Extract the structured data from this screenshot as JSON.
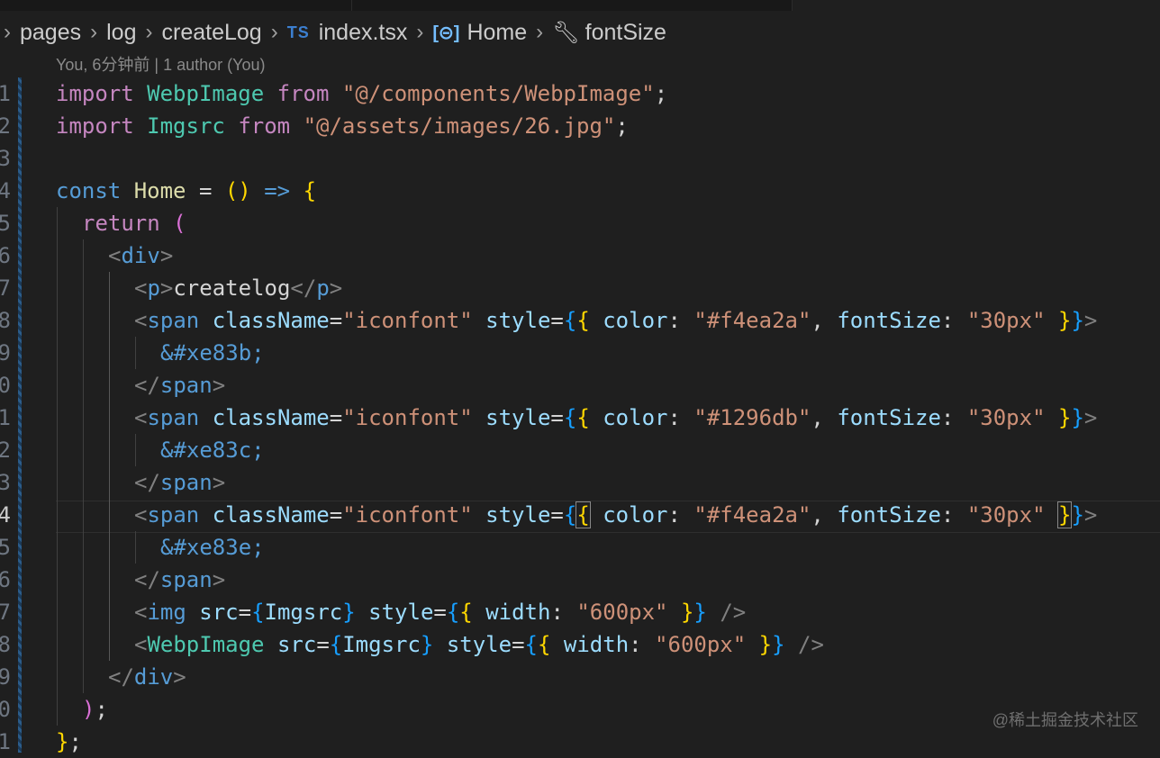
{
  "breadcrumb": {
    "items": [
      "pages",
      "log",
      "createLog",
      "index.tsx",
      "Home",
      "fontSize"
    ],
    "file_badge": "TS"
  },
  "blame": "You, 6分钟前 | 1 author (You)",
  "line_numbers": [
    "1",
    "2",
    "3",
    "4",
    "5",
    "6",
    "7",
    "8",
    "9",
    "0",
    "1",
    "2",
    "3",
    "4",
    "5",
    "6",
    "7",
    "8",
    "9",
    "0",
    "1"
  ],
  "code": {
    "l1": [
      "import",
      " ",
      "WebpImage",
      " ",
      "from",
      " ",
      "\"@/components/WebpImage\"",
      ";"
    ],
    "l2": [
      "import",
      " ",
      "Imgsrc",
      " ",
      "from",
      " ",
      "\"@/assets/images/26.jpg\"",
      ";"
    ],
    "l4": [
      "const",
      " ",
      "Home",
      " = ",
      "()",
      " => ",
      "{"
    ],
    "l5": [
      "return",
      " ",
      "("
    ],
    "l6": [
      "<",
      "div",
      ">"
    ],
    "l7": [
      "<",
      "p",
      ">",
      "createlog",
      "</",
      "p",
      ">"
    ],
    "l8": [
      "<",
      "span",
      " ",
      "className",
      "=",
      "\"iconfont\"",
      " ",
      "style",
      "=",
      "{",
      "{",
      " ",
      "color",
      ": ",
      "\"#f4ea2a\"",
      ", ",
      "fontSize",
      ": ",
      "\"30px\"",
      " ",
      "}",
      "}",
      ">"
    ],
    "l9": [
      "&#xe83b;"
    ],
    "l10": [
      "</",
      "span",
      ">"
    ],
    "l11": [
      "<",
      "span",
      " ",
      "className",
      "=",
      "\"iconfont\"",
      " ",
      "style",
      "=",
      "{",
      "{",
      " ",
      "color",
      ": ",
      "\"#1296db\"",
      ", ",
      "fontSize",
      ": ",
      "\"30px\"",
      " ",
      "}",
      "}",
      ">"
    ],
    "l12": [
      "&#xe83c;"
    ],
    "l13": [
      "</",
      "span",
      ">"
    ],
    "l14": [
      "<",
      "span",
      " ",
      "className",
      "=",
      "\"iconfont\"",
      " ",
      "style",
      "=",
      "{",
      "{",
      " ",
      "color",
      ": ",
      "\"#f4ea2a\"",
      ", ",
      "fontSize",
      ": ",
      "\"30px\"",
      " ",
      "}",
      "}",
      ">"
    ],
    "l15": [
      "&#xe83e;"
    ],
    "l16": [
      "</",
      "span",
      ">"
    ],
    "l17": [
      "<",
      "img",
      " ",
      "src",
      "=",
      "{",
      "Imgsrc",
      "}",
      " ",
      "style",
      "=",
      "{",
      "{",
      " ",
      "width",
      ": ",
      "\"600px\"",
      " ",
      "}",
      "}",
      " />"
    ],
    "l18": [
      "<",
      "WebpImage",
      " ",
      "src",
      "=",
      "{",
      "Imgsrc",
      "}",
      " ",
      "style",
      "=",
      "{",
      "{",
      " ",
      "width",
      ": ",
      "\"600px\"",
      " ",
      "}",
      "}",
      " />"
    ],
    "l19": [
      "</",
      "div",
      ">"
    ],
    "l20": [
      ")",
      ";"
    ],
    "l21": [
      "}",
      ";"
    ]
  },
  "active_line_index": 13,
  "watermark": "@稀土掘金技术社区",
  "colors": {
    "background": "#1f1f1f",
    "keyword": "#569cd6",
    "control": "#c586c0",
    "string": "#ce9178",
    "variable": "#9cdcfe",
    "component": "#4ec9b0",
    "bracket_gold": "#ffd700",
    "bracket_magenta": "#da70d6",
    "bracket_blue": "#179fff"
  },
  "icons": [
    "chevron-right-icon",
    "typescript-file-icon",
    "symbol-variable-icon",
    "wrench-icon"
  ]
}
